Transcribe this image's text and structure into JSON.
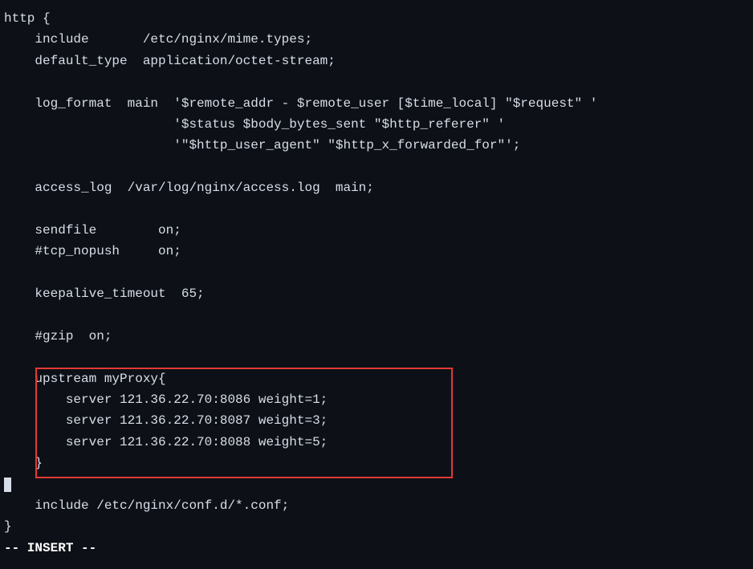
{
  "config": {
    "line01": "http {",
    "line02": "    include       /etc/nginx/mime.types;",
    "line03": "    default_type  application/octet-stream;",
    "line04": "",
    "line05": "    log_format  main  '$remote_addr - $remote_user [$time_local] \"$request\" '",
    "line06": "                      '$status $body_bytes_sent \"$http_referer\" '",
    "line07": "                      '\"$http_user_agent\" \"$http_x_forwarded_for\"';",
    "line08": "",
    "line09": "    access_log  /var/log/nginx/access.log  main;",
    "line10": "",
    "line11": "    sendfile        on;",
    "line12": "    #tcp_nopush     on;",
    "line13": "",
    "line14": "    keepalive_timeout  65;",
    "line15": "",
    "line16": "    #gzip  on;",
    "line17": "",
    "line18": "    upstream myProxy{",
    "line19": "        server 121.36.22.70:8086 weight=1;",
    "line20": "        server 121.36.22.70:8087 weight=3;",
    "line21": "        server 121.36.22.70:8088 weight=5;",
    "line22": "    }",
    "line23": "",
    "line24": "    include /etc/nginx/conf.d/*.conf;",
    "line25": "}"
  },
  "editor": {
    "mode_status": "-- INSERT --"
  }
}
